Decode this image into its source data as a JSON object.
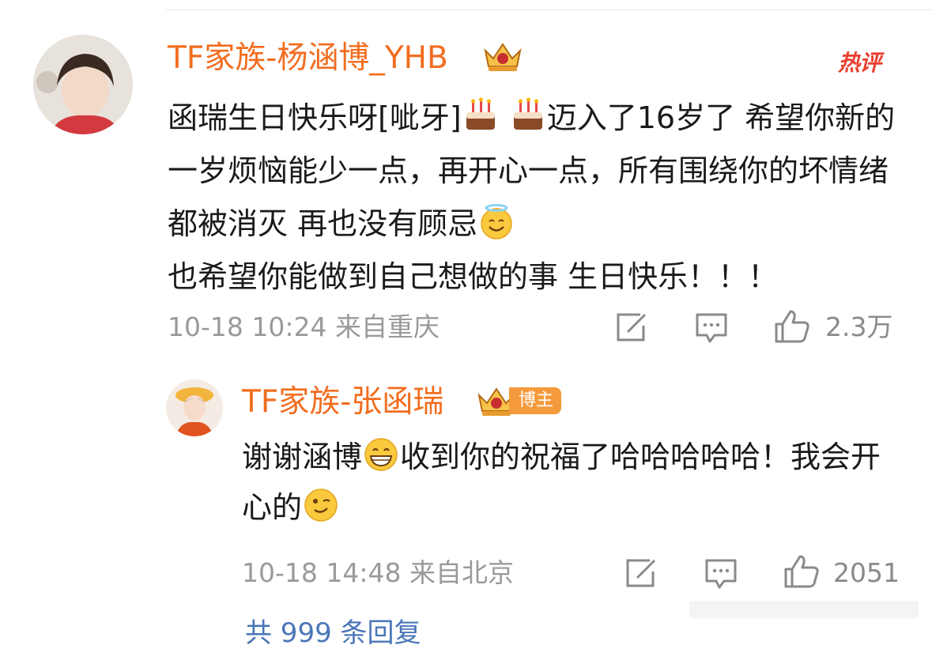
{
  "comment": {
    "username": "TF家族-杨涵博_YHB",
    "hot_label": "热评",
    "content_parts": [
      "函瑞生日快乐呀[呲牙]",
      "迈入了16岁了 希望你新的一岁烦恼能少一点，再开心一点，所有围绕你的坏情绪都被消灭 再也没有顾忌",
      "也希望你能做到自己想做的事 生日快乐！！！"
    ],
    "meta": "10-18 10:24 来自重庆",
    "likes": "2.3万",
    "emojis": [
      "cake-emoji",
      "cake-emoji",
      "halo-smile-emoji"
    ]
  },
  "reply": {
    "username": "TF家族-张函瑞",
    "author_badge": "博主",
    "content_parts": [
      "谢谢涵博",
      "收到你的祝福了哈哈哈哈哈！我会开心的"
    ],
    "meta": "10-18 14:48 来自北京",
    "likes": "2051",
    "emojis": [
      "grin-emoji",
      "wink-emoji"
    ]
  },
  "footer": {
    "more_replies": "共 999 条回复"
  },
  "colors": {
    "username": "#f26d1f",
    "meta": "#9a9a9a",
    "hot": "#e8412f",
    "badge": "#f59a3c",
    "link": "#4a76b8"
  }
}
